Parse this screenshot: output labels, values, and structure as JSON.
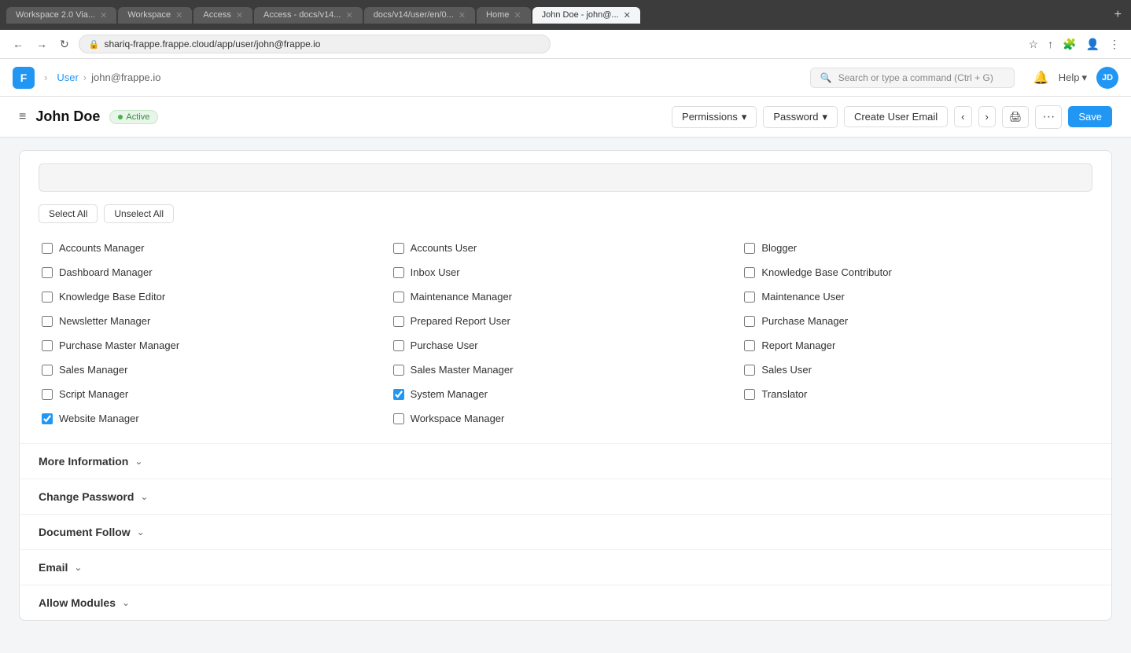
{
  "browser": {
    "tabs": [
      {
        "id": "tab1",
        "label": "Workspace 2.0 Via...",
        "active": false
      },
      {
        "id": "tab2",
        "label": "Workspace",
        "active": false
      },
      {
        "id": "tab3",
        "label": "Access",
        "active": false
      },
      {
        "id": "tab4",
        "label": "Access - docs/v14...",
        "active": false
      },
      {
        "id": "tab5",
        "label": "docs/v14/user/en/0...",
        "active": false
      },
      {
        "id": "tab6",
        "label": "Home",
        "active": false
      },
      {
        "id": "tab7",
        "label": "John Doe - john@...",
        "active": true
      }
    ],
    "address": {
      "protocol": "shariq-frappe.frappe.cloud",
      "path": "/app/user/john@frappe.io",
      "full": "shariq-frappe.frappe.cloud/app/user/john@frappe.io"
    }
  },
  "header": {
    "logo": "F",
    "breadcrumb": [
      "User",
      "john@frappe.io"
    ],
    "search_placeholder": "Search or type a command (Ctrl + G)",
    "help_label": "Help",
    "avatar_initials": "JD"
  },
  "page": {
    "title": "John Doe",
    "status": "Active",
    "status_color": "#388e3c",
    "actions": {
      "permissions_label": "Permissions",
      "password_label": "Password",
      "create_user_email_label": "Create User Email",
      "save_label": "Save"
    }
  },
  "roles": {
    "search_placeholder": "",
    "select_all_label": "Select All",
    "unselect_all_label": "Unselect All",
    "checkboxes": [
      {
        "id": "accounts-manager",
        "label": "Accounts Manager",
        "checked": false,
        "col": 0
      },
      {
        "id": "accounts-user",
        "label": "Accounts User",
        "checked": false,
        "col": 1
      },
      {
        "id": "blogger",
        "label": "Blogger",
        "checked": false,
        "col": 2
      },
      {
        "id": "dashboard-manager",
        "label": "Dashboard Manager",
        "checked": false,
        "col": 0
      },
      {
        "id": "inbox-user",
        "label": "Inbox User",
        "checked": false,
        "col": 1
      },
      {
        "id": "knowledge-base-contributor",
        "label": "Knowledge Base Contributor",
        "checked": false,
        "col": 2
      },
      {
        "id": "knowledge-base-editor",
        "label": "Knowledge Base Editor",
        "checked": false,
        "col": 0
      },
      {
        "id": "maintenance-manager",
        "label": "Maintenance Manager",
        "checked": false,
        "col": 1
      },
      {
        "id": "maintenance-user",
        "label": "Maintenance User",
        "checked": false,
        "col": 2
      },
      {
        "id": "newsletter-manager",
        "label": "Newsletter Manager",
        "checked": false,
        "col": 0
      },
      {
        "id": "prepared-report-user",
        "label": "Prepared Report User",
        "checked": false,
        "col": 1
      },
      {
        "id": "purchase-manager",
        "label": "Purchase Manager",
        "checked": false,
        "col": 2
      },
      {
        "id": "purchase-master-manager",
        "label": "Purchase Master Manager",
        "checked": false,
        "col": 0
      },
      {
        "id": "purchase-user",
        "label": "Purchase User",
        "checked": false,
        "col": 1
      },
      {
        "id": "report-manager",
        "label": "Report Manager",
        "checked": false,
        "col": 2
      },
      {
        "id": "sales-manager",
        "label": "Sales Manager",
        "checked": false,
        "col": 0
      },
      {
        "id": "sales-master-manager",
        "label": "Sales Master Manager",
        "checked": false,
        "col": 1
      },
      {
        "id": "sales-user",
        "label": "Sales User",
        "checked": false,
        "col": 2
      },
      {
        "id": "script-manager",
        "label": "Script Manager",
        "checked": false,
        "col": 0
      },
      {
        "id": "system-manager",
        "label": "System Manager",
        "checked": true,
        "col": 1
      },
      {
        "id": "translator",
        "label": "Translator",
        "checked": false,
        "col": 2
      },
      {
        "id": "website-manager",
        "label": "Website Manager",
        "checked": true,
        "col": 0
      },
      {
        "id": "workspace-manager",
        "label": "Workspace Manager",
        "checked": false,
        "col": 1
      }
    ]
  },
  "sections": [
    {
      "id": "more-information",
      "label": "More Information"
    },
    {
      "id": "change-password",
      "label": "Change Password"
    },
    {
      "id": "document-follow",
      "label": "Document Follow"
    },
    {
      "id": "email",
      "label": "Email"
    },
    {
      "id": "allow-modules",
      "label": "Allow Modules"
    }
  ]
}
